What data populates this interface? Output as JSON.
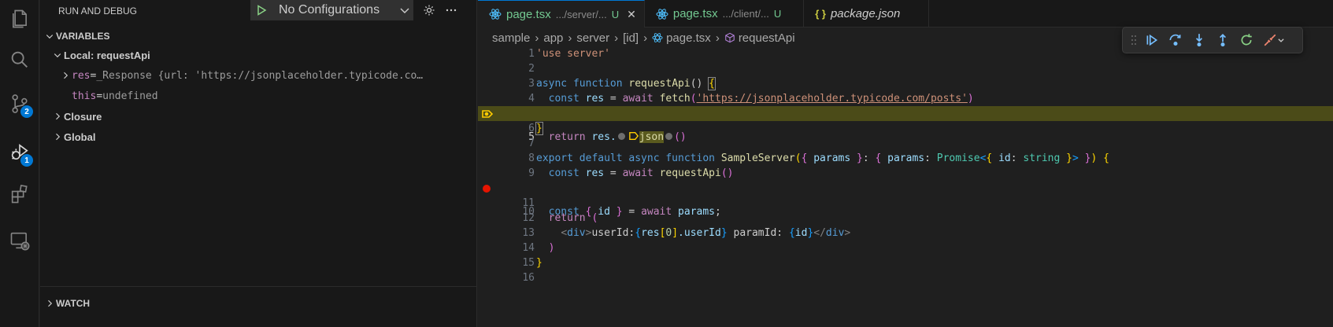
{
  "colors": {
    "accent": "#0078d4",
    "badge": "#0078d4",
    "stopped_line": "#4b4b18",
    "breakpoint": "#e51400",
    "debug_pointer": "#ffcc00"
  },
  "activity_bar": {
    "items": [
      {
        "icon": "files-icon"
      },
      {
        "icon": "search-icon"
      },
      {
        "icon": "source-control-icon",
        "badge": "2"
      },
      {
        "icon": "run-debug-icon",
        "badge": "1"
      },
      {
        "icon": "extensions-icon"
      },
      {
        "icon": "remote-explorer-icon"
      }
    ]
  },
  "sidebar": {
    "title": "RUN AND DEBUG",
    "config": {
      "label": "No Configurations"
    },
    "sections": {
      "variables": "VARIABLES",
      "local_scope": "Local: requestApi",
      "vars": [
        {
          "name": "res",
          "eq": " = ",
          "value": "_Response {url: 'https://jsonplaceholder.typicode.co…"
        },
        {
          "name": "this",
          "eq": " = ",
          "value": "undefined"
        }
      ],
      "closure": "Closure",
      "global": "Global",
      "watch": "WATCH"
    }
  },
  "editor": {
    "tabs": [
      {
        "name": "page.tsx",
        "path": ".../server/...",
        "status": "U",
        "close": "✕"
      },
      {
        "name": "page.tsx",
        "path": ".../client/...",
        "status": "U"
      },
      {
        "name": "package.json",
        "icon": "{ }"
      }
    ],
    "breadcrumbs": [
      "sample",
      "app",
      "server",
      "[id]",
      "page.tsx",
      "requestApi"
    ],
    "line_numbers": [
      "1",
      "2",
      "3",
      "4",
      "5",
      "6",
      "7",
      "8",
      "9",
      "10",
      "11",
      "12",
      "13",
      "14",
      "15",
      "16"
    ],
    "code": {
      "l1": "'use server'",
      "l3_kw": "async function ",
      "l3_fn": "requestApi",
      "l3_rest": "() ",
      "l3_br": "{",
      "l4_kw": "const ",
      "l4_var": "res",
      "l4_eq": " = ",
      "l4_await": "await ",
      "l4_fn": "fetch",
      "l4_p1": "(",
      "l4_str": "'https://jsonplaceholder.typicode.com/posts'",
      "l4_p2": ")",
      "l5_kw": "return ",
      "l5_var": "res.",
      "l5_fn": "json",
      "l5_paren": "()",
      "l6_br": "}",
      "l8_kw": "export default async function ",
      "l8_fn": "SampleServer",
      "l8_a": "(",
      "l8_b": "{ ",
      "l8_c": "params",
      "l8_d": " }",
      "l8_e": ": ",
      "l8_f": "{ ",
      "l8_g": "params",
      "l8_h": ": ",
      "l8_i": "Promise",
      "l8_j": "<",
      "l8_k": "{ ",
      "l8_l": "id",
      "l8_m": ": ",
      "l8_n": "string",
      "l8_o": " }",
      "l8_p": ">",
      "l8_q": " }",
      "l8_r": ") ",
      "l8_s": "{",
      "l9_kw": "const ",
      "l9_var": "res",
      "l9_eq": " = ",
      "l9_await": "await ",
      "l9_fn": "requestApi",
      "l9_p": "()",
      "l10_kw": "const ",
      "l10_b1": "{ ",
      "l10_var": "id",
      "l10_b2": " }",
      "l10_eq": " = ",
      "l10_await": "await ",
      "l10_var2": "params",
      "l10_semi": ";",
      "l12_kw": "return ",
      "l12_p": "(",
      "l13_t1": "<",
      "l13_tag": "div",
      "l13_t2": ">",
      "l13_txt1": "userId:",
      "l13_b1": "{",
      "l13_res": "res",
      "l13_sq1": "[",
      "l13_zero": "0",
      "l13_sq2": "]",
      "l13_uid": ".userId",
      "l13_b2": "}",
      "l13_txt2": " paramId: ",
      "l13_b3": "{",
      "l13_id": "id",
      "l13_b4": "}",
      "l13_t3": "</",
      "l13_tag2": "div",
      "l13_t4": ">",
      "l14_p": ")",
      "l15_br": "}"
    }
  },
  "debug_toolbar": {
    "buttons": [
      "continue-icon",
      "step-over-icon",
      "step-into-icon",
      "step-out-icon",
      "restart-icon",
      "disconnect-icon"
    ]
  }
}
